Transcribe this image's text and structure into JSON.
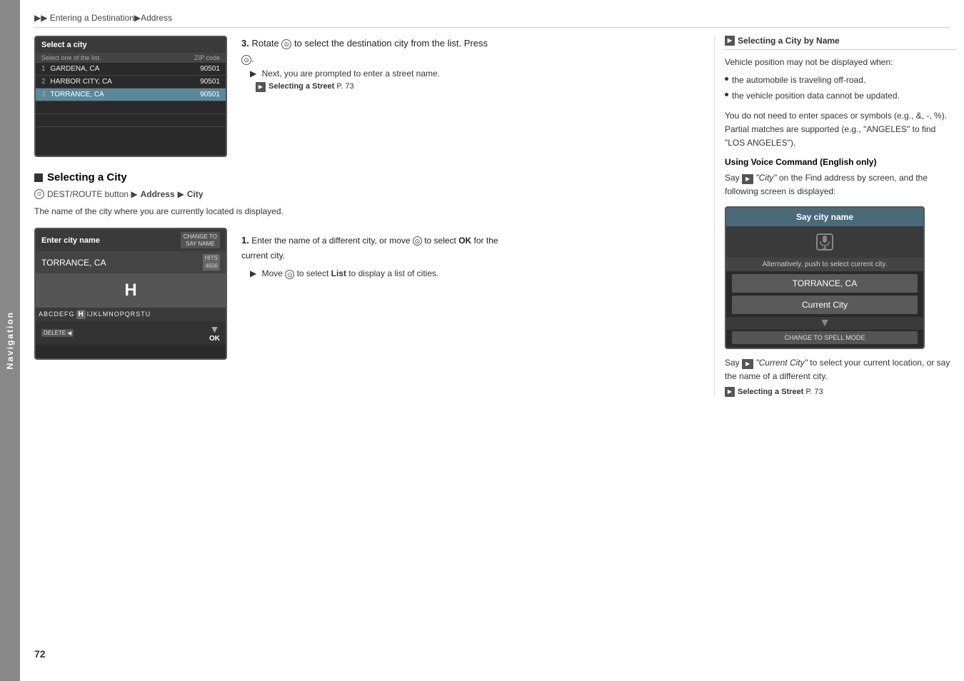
{
  "breadcrumb": {
    "parts": [
      "▶▶ Entering a Destination",
      "▶ Address"
    ]
  },
  "page_number": "72",
  "side_label": "Navigation",
  "select_city_screen": {
    "title": "Select a city",
    "col1": "Select one of the list.",
    "col2": "ZIP code",
    "rows": [
      {
        "num": "1",
        "city": "GARDENA, CA",
        "zip": "90501"
      },
      {
        "num": "2",
        "city": "HARBOR CITY, CA",
        "zip": "90501"
      },
      {
        "num": "3",
        "city": "TORRANCE, CA",
        "zip": "90501",
        "selected": true
      }
    ]
  },
  "step3": {
    "label": "3.",
    "text": "Rotate",
    "rotate_icon": "⊙",
    "text2": "to select the destination city from the list. Press",
    "press_icon": "⊙",
    "sub1": "Next, you are prompted to enter a street name.",
    "ref_label": "Selecting a Street",
    "ref_page": "P. 73"
  },
  "selecting_city_heading": "Selecting a City",
  "dest_route_line": {
    "icon": "⊙",
    "text": "DEST/ROUTE button ▶",
    "bold1": "Address",
    "arrow": "▶",
    "bold2": "City"
  },
  "desc_text": "The name of the city where you are currently located is displayed.",
  "enter_city_screen": {
    "title": "Enter city name",
    "change_btn_line1": "CHANGE TO",
    "change_btn_line2": "SAY NAME",
    "city": "TORRANCE, CA",
    "hits_line1": "HITS",
    "hits_line2": "4606",
    "char": "H",
    "keyboard": "ABCDEFG  H  IJKLMNOPQRSTU",
    "delete_label": "DELETE",
    "ok_label": "OK"
  },
  "step1": {
    "label": "1.",
    "text": "Enter the name of a different city, or move",
    "move_icon": "⊙",
    "text2": "to select",
    "bold1": "OK",
    "text3": "for the current city.",
    "sub1": "Move",
    "sub_icon": "⊙",
    "sub_text2": "to select",
    "sub_bold": "List",
    "sub_text3": "to display a list of cities."
  },
  "right_note": {
    "title": "Selecting a City by Name",
    "body_intro": "Vehicle position may not be displayed when:",
    "bullets": [
      "the automobile is traveling off-road.",
      "the vehicle position data cannot be updated."
    ],
    "extra_text": "You do not need to enter spaces or symbols (e.g., &, -, %). Partial matches are supported (e.g., \"ANGELES\" to find \"LOS ANGELES\").",
    "voice_cmd_title": "Using Voice Command (English only)",
    "voice_cmd_text1": "Say",
    "voice_cmd_icon": "▶◀",
    "voice_cmd_city": "\"City\"",
    "voice_cmd_text2": "on the Find address by screen, and the following screen is displayed:",
    "say_city_screen": {
      "title": "Say city name",
      "alt_text": "Alternatively, push to select current city.",
      "city_btn": "TORRANCE, CA",
      "current_btn": "Current City",
      "spell_btn": "CHANGE TO SPELL MODE"
    },
    "bottom_text1": "Say",
    "bottom_icon": "▶◀",
    "bottom_italic": "\"Current City\"",
    "bottom_text2": "to select your current location, or say the name of a different city.",
    "bottom_ref_label": "Selecting a Street",
    "bottom_ref_page": "P. 73"
  }
}
